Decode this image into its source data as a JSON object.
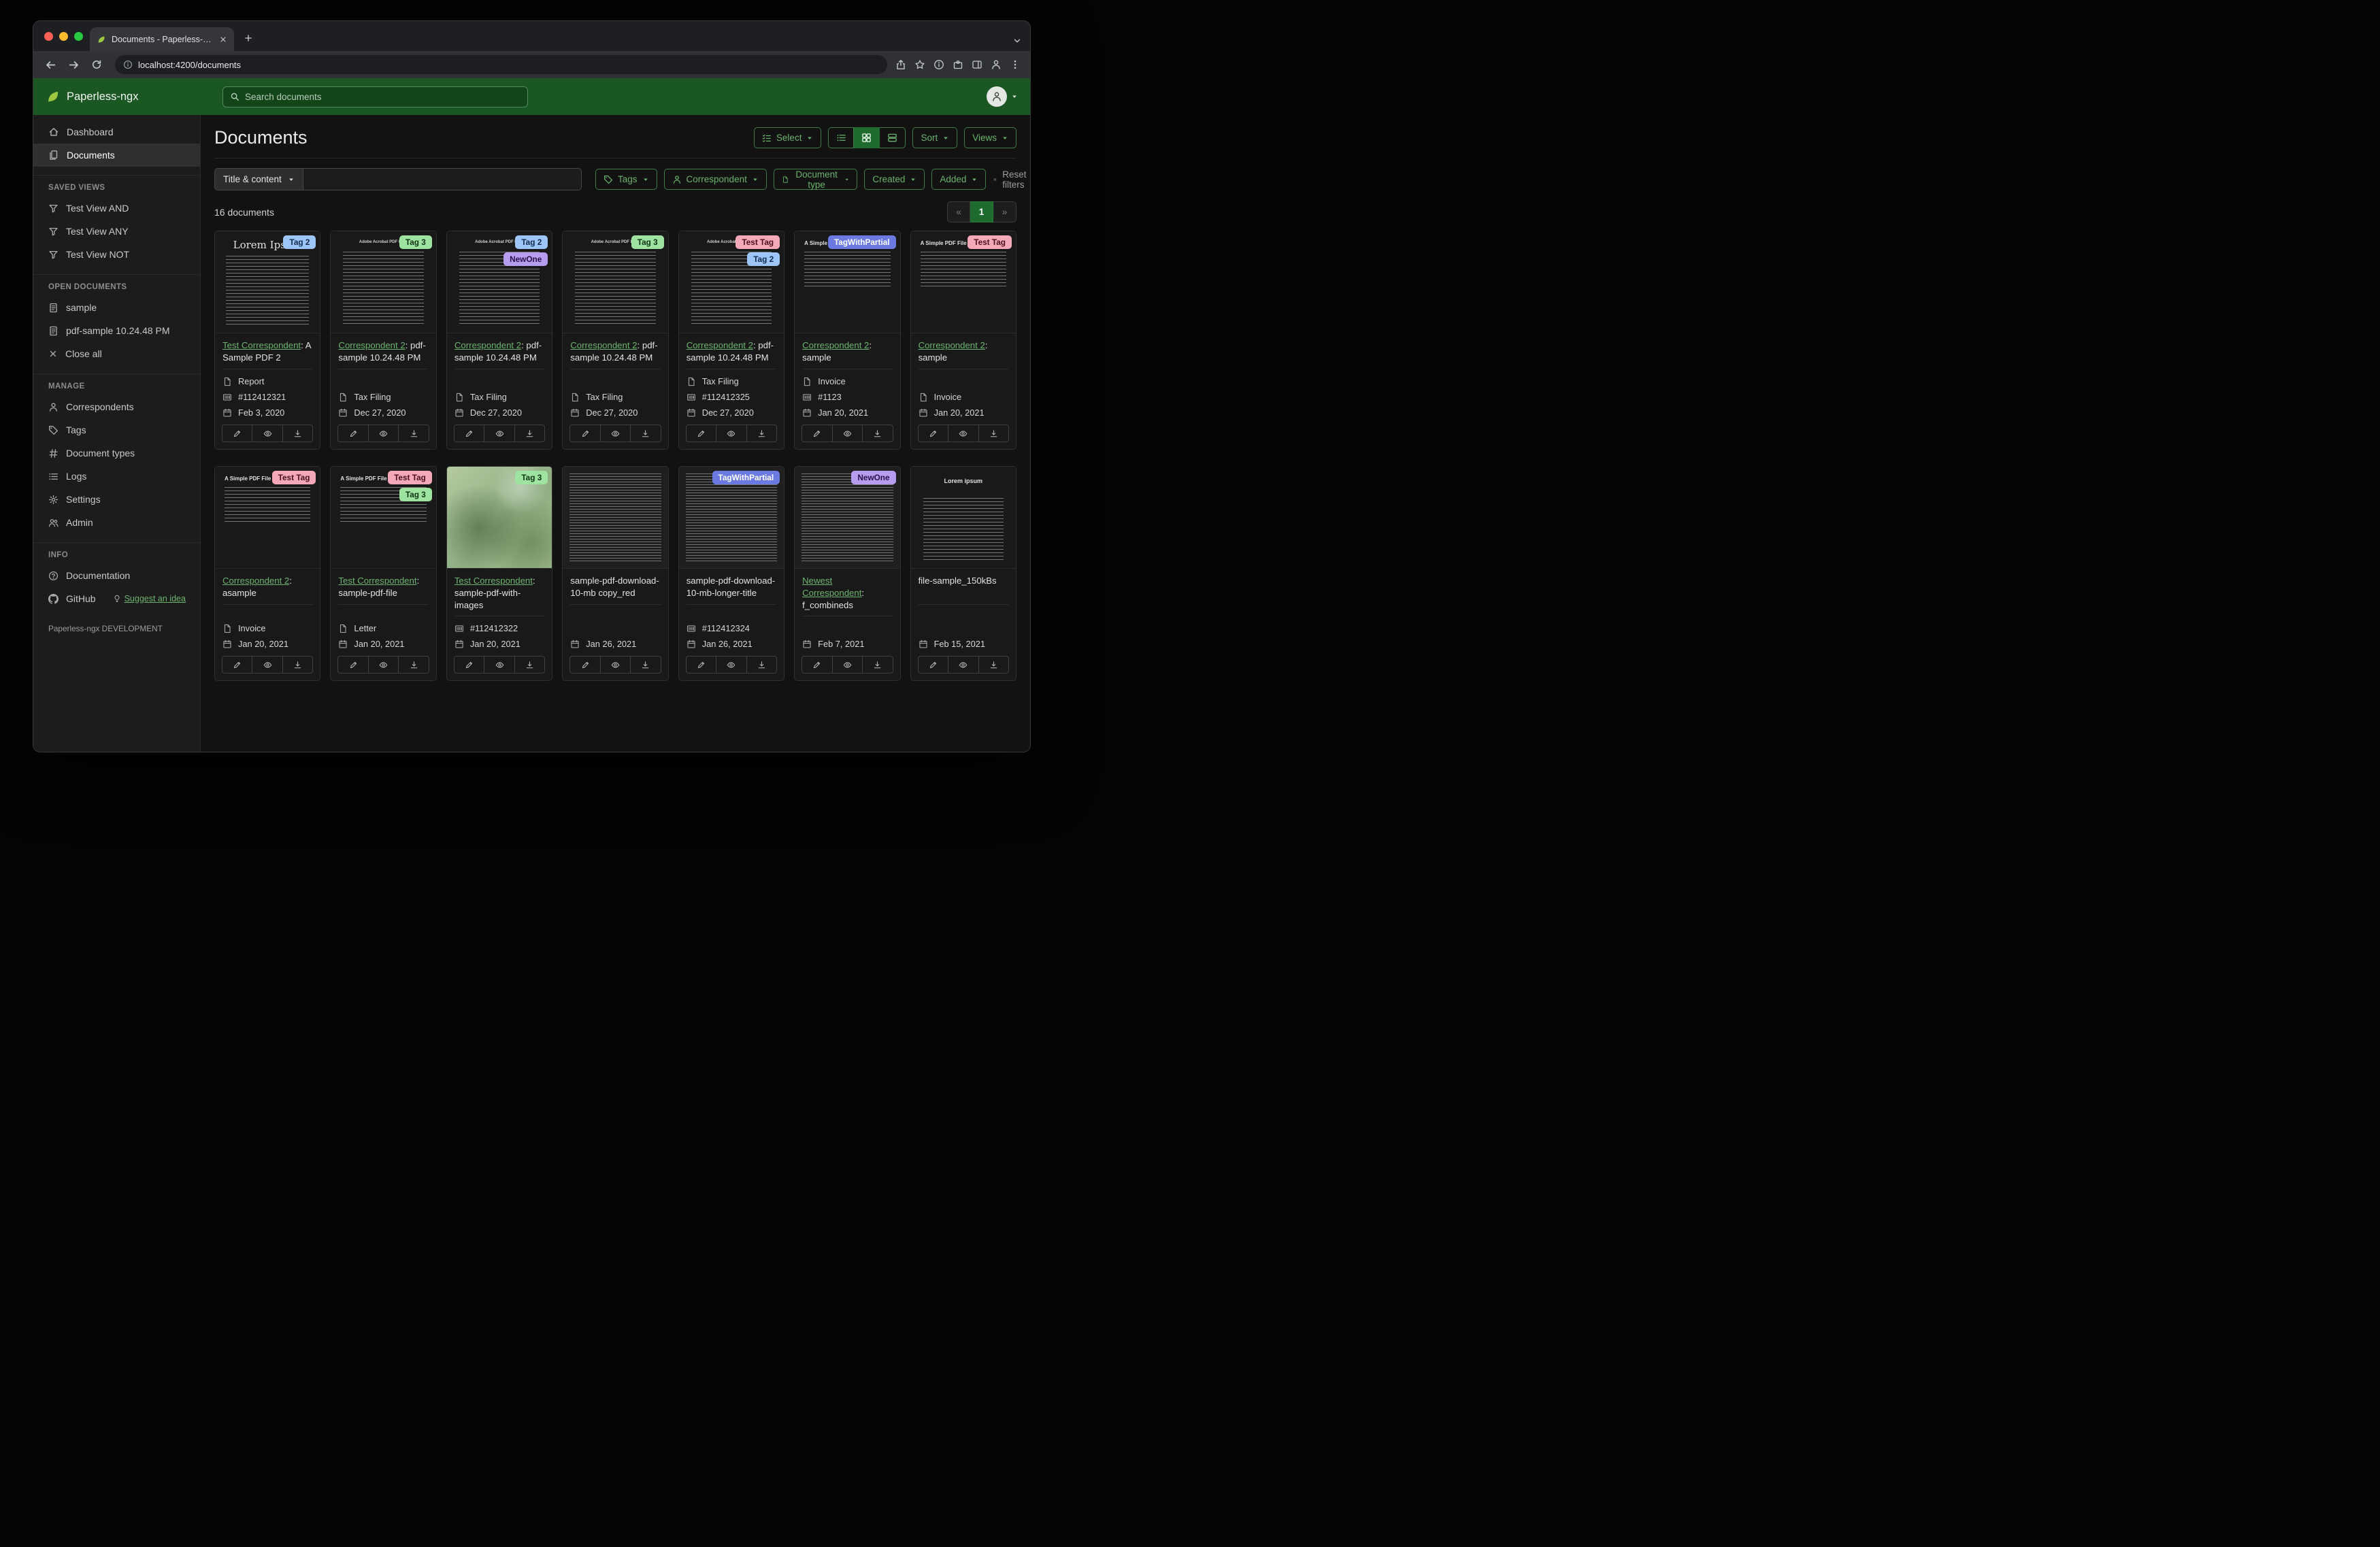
{
  "colors": {
    "header_green": "#1a5723",
    "accent_green": "#1f6b2d",
    "link_green": "#6db46f",
    "brand_leaf": "#9bc83f",
    "traffic_red": "#ff5f57",
    "traffic_yellow": "#febc2e",
    "traffic_green": "#28c840"
  },
  "browser": {
    "tab_title": "Documents - Paperless-ngx",
    "url": "localhost:4200/documents"
  },
  "app_header": {
    "brand": "Paperless-ngx",
    "search_placeholder": "Search documents"
  },
  "sidebar": {
    "nav": [
      {
        "label": "Dashboard"
      },
      {
        "label": "Documents"
      }
    ],
    "saved_views": {
      "title": "SAVED VIEWS",
      "items": [
        {
          "label": "Test View AND"
        },
        {
          "label": "Test View ANY"
        },
        {
          "label": "Test View NOT"
        }
      ]
    },
    "open_documents": {
      "title": "OPEN DOCUMENTS",
      "items": [
        {
          "label": "sample"
        },
        {
          "label": "pdf-sample 10.24.48 PM"
        }
      ],
      "close_all": "Close all"
    },
    "manage": {
      "title": "MANAGE",
      "items": [
        {
          "label": "Correspondents"
        },
        {
          "label": "Tags"
        },
        {
          "label": "Document types"
        },
        {
          "label": "Logs"
        },
        {
          "label": "Settings"
        },
        {
          "label": "Admin"
        }
      ]
    },
    "info": {
      "title": "INFO",
      "items": [
        {
          "label": "Documentation"
        },
        {
          "label": "GitHub"
        }
      ],
      "suggest": "Suggest an idea"
    },
    "footer": "Paperless-ngx DEVELOPMENT"
  },
  "page": {
    "title": "Documents",
    "select_label": "Select",
    "sort_label": "Sort",
    "views_label": "Views",
    "count": "16 documents",
    "pagination": {
      "prev": "«",
      "page": "1",
      "next": "»"
    },
    "filters": {
      "field": "Title & content",
      "tags": "Tags",
      "correspondent": "Correspondent",
      "document_type": "Document type",
      "created": "Created",
      "added": "Added",
      "reset": "Reset filters"
    }
  },
  "tag_colors": {
    "blue": {
      "bg": "#9ec5f8",
      "fg": "#0f2a4a"
    },
    "green": {
      "bg": "#9fe3a1",
      "fg": "#0f3312"
    },
    "pink": {
      "bg": "#f5a8b8",
      "fg": "#4a0f1e"
    },
    "purple": {
      "bg": "#b79df0",
      "fg": "#2a1048"
    },
    "indigo": {
      "bg": "#6b7ae0",
      "fg": "#ffffff"
    }
  },
  "cards": [
    {
      "tags": [
        {
          "label": "Tag 2",
          "color": "blue"
        }
      ],
      "title_link": "Test Correspondent",
      "title_rest": ": A Sample PDF 2",
      "type": "Report",
      "asn": "#112412321",
      "date": "Feb 3, 2020",
      "thumb": {
        "kind": "lorem",
        "heading": "Lorem Ipsum"
      }
    },
    {
      "tags": [
        {
          "label": "Tag 3",
          "color": "green"
        }
      ],
      "title_link": "Correspondent 2",
      "title_rest": ": pdf-sample 10.24.48 PM",
      "type": "Tax Filing",
      "date": "Dec 27, 2020",
      "thumb": {
        "kind": "adobe",
        "heading": "Adobe Acrobat PDF Files"
      }
    },
    {
      "tags": [
        {
          "label": "Tag 2",
          "color": "blue"
        },
        {
          "label": "NewOne",
          "color": "purple"
        }
      ],
      "title_link": "Correspondent 2",
      "title_rest": ": pdf-sample 10.24.48 PM",
      "type": "Tax Filing",
      "date": "Dec 27, 2020",
      "thumb": {
        "kind": "adobe",
        "heading": "Adobe Acrobat PDF Files"
      }
    },
    {
      "tags": [
        {
          "label": "Tag 3",
          "color": "green"
        }
      ],
      "title_link": "Correspondent 2",
      "title_rest": ": pdf-sample 10.24.48 PM",
      "type": "Tax Filing",
      "date": "Dec 27, 2020",
      "thumb": {
        "kind": "adobe",
        "heading": "Adobe Acrobat PDF Files"
      }
    },
    {
      "tags": [
        {
          "label": "Test Tag",
          "color": "pink"
        },
        {
          "label": "Tag 2",
          "color": "blue"
        }
      ],
      "title_link": "Correspondent 2",
      "title_rest": ": pdf-sample 10.24.48 PM",
      "type": "Tax Filing",
      "asn": "#112412325",
      "date": "Dec 27, 2020",
      "thumb": {
        "kind": "adobe",
        "heading": "Adobe Acrobat PDF Files"
      }
    },
    {
      "tags": [
        {
          "label": "TagWithPartial",
          "color": "indigo"
        }
      ],
      "title_link": "Correspondent 2",
      "title_rest": ": sample",
      "type": "Invoice",
      "asn": "#1123",
      "date": "Jan 20, 2021",
      "thumb": {
        "kind": "simple",
        "heading": "A Simple PDF File"
      }
    },
    {
      "tags": [
        {
          "label": "Test Tag",
          "color": "pink"
        }
      ],
      "title_link": "Correspondent 2",
      "title_rest": ": sample",
      "type": "Invoice",
      "date": "Jan 20, 2021",
      "thumb": {
        "kind": "simple",
        "heading": "A Simple PDF File"
      }
    },
    {
      "tags": [
        {
          "label": "Test Tag",
          "color": "pink"
        }
      ],
      "title_link": "Correspondent 2",
      "title_rest": ": asample",
      "type": "Invoice",
      "date": "Jan 20, 2021",
      "thumb": {
        "kind": "simple",
        "heading": "A Simple PDF File"
      }
    },
    {
      "tags": [
        {
          "label": "Test Tag",
          "color": "pink"
        },
        {
          "label": "Tag 3",
          "color": "green"
        }
      ],
      "title_link": "Test Correspondent",
      "title_rest": ": sample-pdf-file",
      "type": "Letter",
      "date": "Jan 20, 2021",
      "thumb": {
        "kind": "simple",
        "heading": "A Simple PDF File"
      }
    },
    {
      "tags": [
        {
          "label": "Tag 3",
          "color": "green"
        }
      ],
      "title_link": "Test Correspondent",
      "title_rest": ": sample-pdf-with-images",
      "asn": "#112412322",
      "date": "Jan 20, 2021",
      "thumb": {
        "kind": "map"
      }
    },
    {
      "tags": [],
      "title_rest": "sample-pdf-download-10-mb copy_red",
      "date": "Jan 26, 2021",
      "thumb": {
        "kind": "dense"
      }
    },
    {
      "tags": [
        {
          "label": "TagWithPartial",
          "color": "indigo"
        }
      ],
      "title_rest": "sample-pdf-download-10-mb-longer-title",
      "asn": "#112412324",
      "date": "Jan 26, 2021",
      "thumb": {
        "kind": "dense"
      }
    },
    {
      "tags": [
        {
          "label": "NewOne",
          "color": "purple"
        }
      ],
      "title_link": "Newest Correspondent",
      "title_rest": ": f_combineds",
      "date": "Feb 7, 2021",
      "thumb": {
        "kind": "dense"
      }
    },
    {
      "tags": [],
      "title_rest": "file-sample_150kBs",
      "date": "Feb 15, 2021",
      "thumb": {
        "kind": "lorem-center",
        "heading": "Lorem ipsum"
      }
    }
  ]
}
